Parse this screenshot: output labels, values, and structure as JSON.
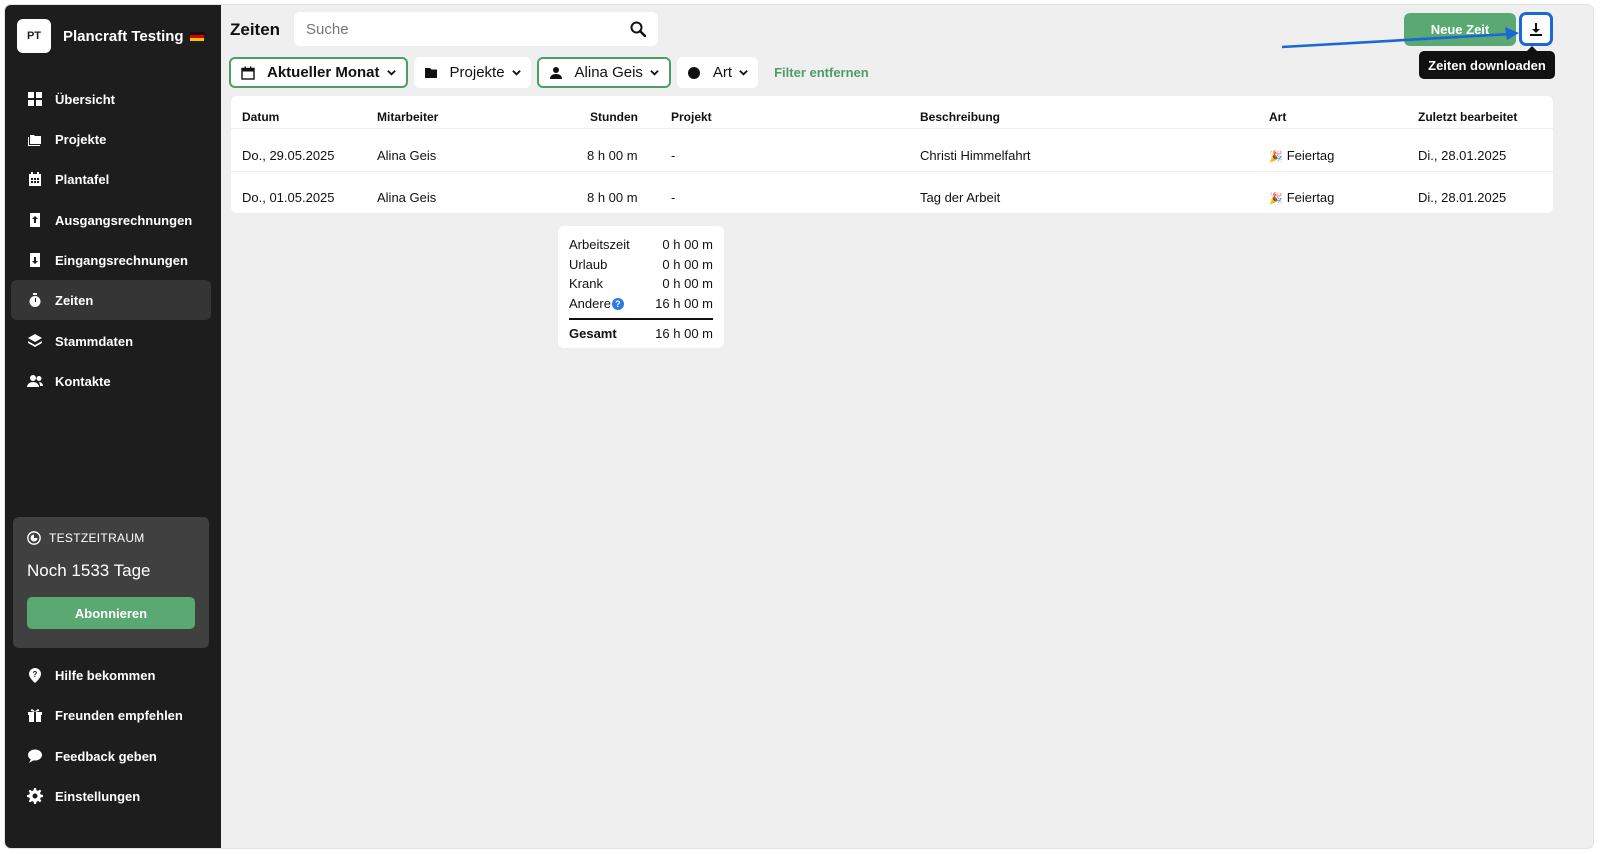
{
  "brand": {
    "initials": "PT",
    "name": "Plancraft Testing"
  },
  "nav": [
    {
      "label": "Übersicht",
      "icon": "grid-icon"
    },
    {
      "label": "Projekte",
      "icon": "folders-icon"
    },
    {
      "label": "Plantafel",
      "icon": "calendar-icon"
    },
    {
      "label": "Ausgangsrechnungen",
      "icon": "invoice-out-icon"
    },
    {
      "label": "Eingangsrechnungen",
      "icon": "invoice-in-icon"
    },
    {
      "label": "Zeiten",
      "icon": "stopwatch-icon",
      "active": true
    },
    {
      "label": "Stammdaten",
      "icon": "layers-icon"
    },
    {
      "label": "Kontakte",
      "icon": "users-icon"
    }
  ],
  "trial": {
    "heading": "TESTZEITRAUM",
    "days": "Noch 1533 Tage",
    "button": "Abonnieren"
  },
  "bottom_nav": [
    {
      "label": "Hilfe bekommen",
      "icon": "help-pin-icon"
    },
    {
      "label": "Freunden empfehlen",
      "icon": "gift-icon"
    },
    {
      "label": "Feedback geben",
      "icon": "chat-icon"
    },
    {
      "label": "Einstellungen",
      "icon": "gear-icon"
    }
  ],
  "header": {
    "title": "Zeiten",
    "search_placeholder": "Suche",
    "new_button": "Neue Zeit",
    "download_tooltip": "Zeiten downloaden"
  },
  "filters": {
    "period": "Aktueller Monat",
    "projects": "Projekte",
    "employee": "Alina Geis",
    "type": "Art",
    "clear": "Filter entfernen"
  },
  "table": {
    "columns": [
      "Datum",
      "Mitarbeiter",
      "Stunden",
      "Projekt",
      "Beschreibung",
      "Art",
      "Zuletzt bearbeitet"
    ],
    "rows": [
      {
        "date": "Do., 29.05.2025",
        "employee": "Alina Geis",
        "hours": "8 h 00 m",
        "project": "-",
        "description": "Christi Himmelfahrt",
        "type": "Feiertag",
        "edited": "Di., 28.01.2025"
      },
      {
        "date": "Do., 01.05.2025",
        "employee": "Alina Geis",
        "hours": "8 h 00 m",
        "project": "-",
        "description": "Tag der Arbeit",
        "type": "Feiertag",
        "edited": "Di., 28.01.2025"
      }
    ]
  },
  "summary": {
    "rows": [
      {
        "label": "Arbeitszeit",
        "value": "0 h 00 m"
      },
      {
        "label": "Urlaub",
        "value": "0 h 00 m"
      },
      {
        "label": "Krank",
        "value": "0 h 00 m"
      },
      {
        "label": "Andere",
        "value": "16 h 00 m"
      }
    ],
    "total_label": "Gesamt",
    "total_value": "16 h 00 m"
  },
  "colors": {
    "accent_green": "#5aa872",
    "highlight_blue": "#1a67d6",
    "sidebar": "#1d1d1d"
  }
}
